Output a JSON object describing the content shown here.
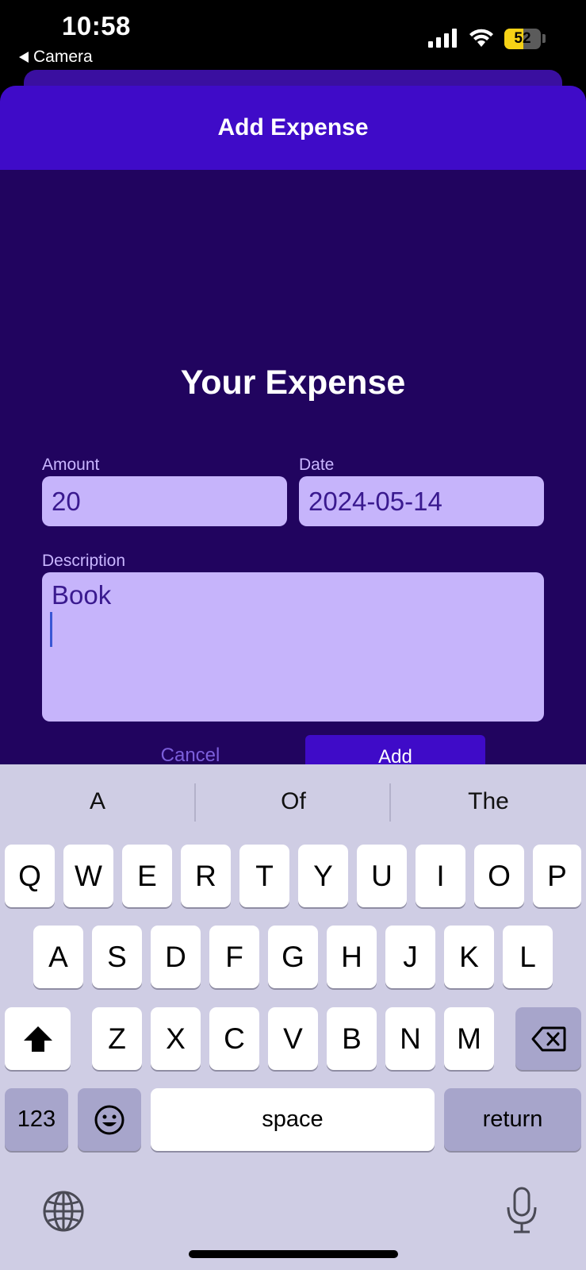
{
  "status_bar": {
    "time": "10:58",
    "back_app": "Camera",
    "battery_level": "52"
  },
  "modal": {
    "title": "Add Expense",
    "section_title": "Your Expense",
    "amount": {
      "label": "Amount",
      "value": "20"
    },
    "date": {
      "label": "Date",
      "value": "2024-05-14"
    },
    "description": {
      "label": "Description",
      "value": "Book"
    },
    "cancel_label": "Cancel",
    "add_label": "Add"
  },
  "keyboard": {
    "suggestions": [
      "A",
      "Of",
      "The"
    ],
    "row1": [
      "Q",
      "W",
      "E",
      "R",
      "T",
      "Y",
      "U",
      "I",
      "O",
      "P"
    ],
    "row2": [
      "A",
      "S",
      "D",
      "F",
      "G",
      "H",
      "J",
      "K",
      "L"
    ],
    "row3": [
      "Z",
      "X",
      "C",
      "V",
      "B",
      "N",
      "M"
    ],
    "numbers_label": "123",
    "space_label": "space",
    "return_label": "return"
  },
  "colors": {
    "header": "#3f0bc8",
    "background": "#21045f",
    "field": "#c6b4fb"
  }
}
